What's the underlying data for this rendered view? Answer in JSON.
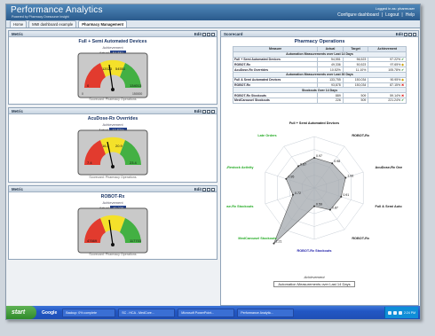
{
  "header": {
    "title": "Performance Analytics",
    "subtitle": "Powered by Pharmacy Onesource Insight",
    "user": "Logged in as: pharmuser",
    "links": [
      "Configure dashboard",
      "|",
      "Logout",
      "|",
      "Help"
    ]
  },
  "tabs": [
    "Home",
    "MMI dashboard example",
    "Pharmacy Management"
  ],
  "metrics": [
    {
      "panel": "Metric",
      "edit": "Edit",
      "title": "Full + Semi Automated Devices",
      "sub": "Achievement",
      "actual_label": "Actual",
      "actual": "54,551",
      "ticks": {
        "left": "0",
        "mid_l": "12023",
        "mid_r": "54551",
        "right": "134013",
        "min": "0",
        "max": "150000"
      },
      "foot": "Scorecard: Pharmacy Operations"
    },
    {
      "panel": "Metric",
      "edit": "Edit",
      "title": "AcuDose-Rx Overrides",
      "sub": "Achievement",
      "actual_label": "Actual",
      "actual": "10.52%",
      "ticks": {
        "left": "7.4",
        "mid_l": "16.4",
        "mid_r": "20.9",
        "right": "23.4",
        "min": "",
        "max": ""
      },
      "foot": "Scorecard: Pharmacy Operations"
    },
    {
      "panel": "Metric",
      "edit": "Edit",
      "title": "ROBOT-Rx",
      "sub": "Achievement",
      "actual_label": "Actual",
      "actual": "49,336",
      "ticks": {
        "left": "47669",
        "mid_l": "",
        "mid_r": "",
        "right": "117703",
        "min": "",
        "max": ""
      },
      "foot": "Scorecard: Pharmacy Operations"
    }
  ],
  "scorecard": {
    "panel": "Scorecard",
    "edit": "Edit",
    "title": "Pharmacy Operations",
    "columns": [
      "Measure",
      "Actual",
      "Target",
      "Achievement"
    ],
    "sections": [
      {
        "label": "Automation Measurements over Last 14 Days",
        "rows": [
          {
            "m": "Full + Semi Automated Devices",
            "a": "54,551",
            "t": "56,523",
            "p": "97.22%",
            "s": "ok"
          },
          {
            "m": "ROBOT-Rx",
            "a": "49,336",
            "t": "50,523",
            "p": "97.65%",
            "s": "warn"
          },
          {
            "m": "AcuDose-Rx Overrides",
            "a": "10.52%",
            "t": "11.10%",
            "p": "105.78%",
            "s": "ok"
          }
        ]
      },
      {
        "label": "Automation Measurements over Last 30 Days",
        "rows": [
          {
            "m": "Full & Semi Automated Devices",
            "a": "133,755",
            "t": "150,034",
            "p": "90.95%",
            "s": "warn"
          },
          {
            "m": "ROBOT-Rx",
            "a": "93,878",
            "t": "150,034",
            "p": "87.15%",
            "s": "bad"
          }
        ]
      },
      {
        "label": "Stockouts Over 14 Days",
        "rows": [
          {
            "m": "ROBOT-Rx Stockouts",
            "a": "889",
            "t": "509",
            "p": "59.14%",
            "s": "bad"
          },
          {
            "m": "MedCarousel Stockouts",
            "a": "226",
            "t": "509",
            "p": "221.24%",
            "s": "ok"
          }
        ]
      }
    ],
    "status_icons": {
      "ok": "✔",
      "warn": "◆",
      "bad": "✖"
    },
    "radar": {
      "axes": [
        "Full + Semi Automated Devices",
        "ROBOT-Rx",
        "AcuDose-Rx Overrides",
        "Full & Semi Automated Devices",
        "ROBOT-Rx",
        "ROBOT-Rx Stockouts",
        "MedCarousel Stockouts",
        "AcuDose-Rx Stockouts",
        "AcuDose-Restock Activity",
        "Late Orders"
      ],
      "values": [
        0.97,
        0.98,
        1.06,
        0.91,
        0.87,
        0.59,
        2.21,
        0.72,
        0.95,
        0.87
      ],
      "colors": [
        "#111",
        "#111",
        "#111",
        "#222",
        "#222",
        "#22a",
        "#2a2",
        "#2a2",
        "#2a2",
        "#2a2"
      ],
      "legend_title": "Achievement",
      "legend_label": "Automation Measurements over Last 14 Days"
    }
  },
  "taskbar": {
    "start": "start",
    "google": "Google",
    "items": [
      "Backup: 0% complete",
      "SC - HCA - MedCore...",
      "Microsoft PowerPoint...",
      "Performance Analytic..."
    ],
    "clock": "2:24 PM"
  },
  "colors": {
    "accent": "#2a5a8c",
    "title": "#1a3566",
    "ok": "#2e8b2e",
    "warn": "#c9a000",
    "bad": "#d22"
  }
}
